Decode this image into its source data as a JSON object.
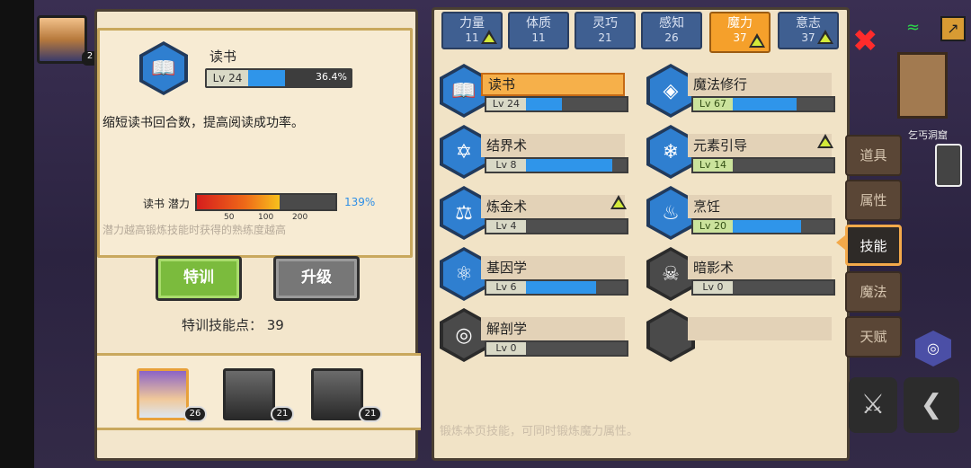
{
  "selected_skill": {
    "name": "读书",
    "icon": "book-icon",
    "level": "Lv 24",
    "progress_pct": "36.4%",
    "progress": 0.364,
    "description": "缩短读书回合数，提高阅读成功率。",
    "potential_label": "读书 潜力",
    "potential_pct": "139%",
    "potential_ticks": [
      "50",
      "100",
      "200"
    ],
    "potential_hint": "潜力越高锻炼技能时获得的熟练度越高"
  },
  "buttons": {
    "train": "特训",
    "upgrade": "升级"
  },
  "train_points": "特训技能点：  39",
  "companions": [
    {
      "name": "companion-mage",
      "level": "26",
      "selected": true
    },
    {
      "name": "companion-beast",
      "level": "21",
      "selected": false
    },
    {
      "name": "companion-golem",
      "level": "21",
      "selected": false
    }
  ],
  "attribute_tabs": [
    {
      "name": "力量",
      "value": "11",
      "up": true,
      "active": false
    },
    {
      "name": "体质",
      "value": "11",
      "up": false,
      "active": false
    },
    {
      "name": "灵巧",
      "value": "21",
      "up": false,
      "active": false
    },
    {
      "name": "感知",
      "value": "26",
      "up": false,
      "active": false
    },
    {
      "name": "魔力",
      "value": "37",
      "up": true,
      "active": true
    },
    {
      "name": "意志",
      "value": "37",
      "up": true,
      "active": false
    }
  ],
  "skills": [
    {
      "name": "读书",
      "level": "Lv 24",
      "progress": 0.36,
      "icon": "book-icon",
      "active": true,
      "up": false,
      "green": false
    },
    {
      "name": "魔法修行",
      "level": "Lv 67",
      "progress": 0.63,
      "icon": "magic-eye-icon",
      "active": false,
      "up": false,
      "green": true
    },
    {
      "name": "结界术",
      "level": "Lv 8",
      "progress": 0.86,
      "icon": "hexagram-icon",
      "active": false,
      "up": false,
      "green": false
    },
    {
      "name": "元素引导",
      "level": "Lv 14",
      "progress": 0.0,
      "icon": "element-icon",
      "active": false,
      "up": true,
      "green": true
    },
    {
      "name": "炼金术",
      "level": "Lv 4",
      "progress": 0.0,
      "icon": "flask-icon",
      "active": false,
      "up": true,
      "green": false
    },
    {
      "name": "烹饪",
      "level": "Lv 20",
      "progress": 0.68,
      "icon": "pot-icon",
      "active": false,
      "up": false,
      "green": true
    },
    {
      "name": "基因学",
      "level": "Lv 6",
      "progress": 0.7,
      "icon": "molecule-icon",
      "active": false,
      "up": false,
      "green": false
    },
    {
      "name": "暗影术",
      "level": "Lv 0",
      "progress": 0.0,
      "icon": "skull-icon",
      "active": false,
      "up": false,
      "green": false
    },
    {
      "name": "解剖学",
      "level": "Lv 0",
      "progress": 0.0,
      "icon": "meat-icon",
      "active": false,
      "up": false,
      "green": false
    }
  ],
  "bottom_hint": "锻炼本页技能，可同时锻炼魔力属性。",
  "side_tabs": [
    {
      "label": "道具",
      "active": false
    },
    {
      "label": "属性",
      "active": false
    },
    {
      "label": "技能",
      "active": true
    },
    {
      "label": "魔法",
      "active": false
    },
    {
      "label": "天赋",
      "active": false
    }
  ],
  "hero_level": "2",
  "map_label": "乞丐洞窟",
  "colors": {
    "accent_orange": "#f5a02b",
    "tab_blue": "#3f5f91",
    "progress_blue": "#2f95ea",
    "train_green": "#7bbb3d"
  }
}
